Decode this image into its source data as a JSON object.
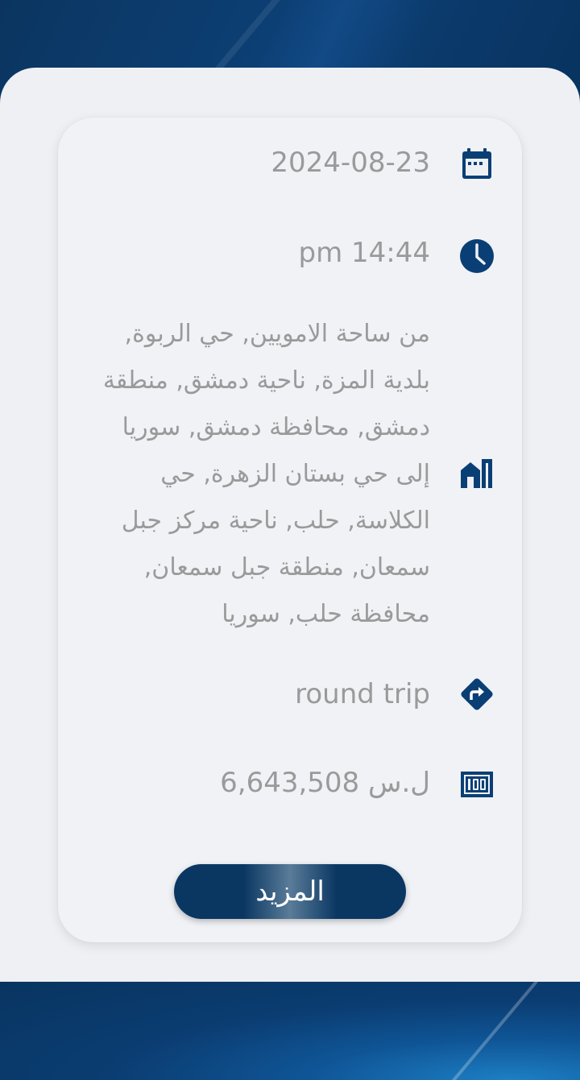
{
  "trip": {
    "date": "2024-08-23",
    "time": "pm 14:44",
    "route": "من ساحة الامويين, حي الربوة, بلدية المزة, ناحية دمشق, منطقة دمشق, محافظة دمشق, سوريا إلى حي بستان الزهرة, حي الكلاسة, حلب, ناحية مركز جبل سمعان, منطقة جبل سمعان, محافظة حلب, سوريا",
    "trip_type": "round trip",
    "price": "6,643,508 ل.س"
  },
  "actions": {
    "more_label": "المزيد"
  },
  "icons": {
    "date": "calendar-icon",
    "time": "clock-icon",
    "route": "buildings-icon",
    "trip_type": "directions-icon",
    "price": "banknote-icon"
  },
  "colors": {
    "icon": "#0a3f75",
    "text": "#9a9a9a",
    "button": "#0a3762"
  }
}
